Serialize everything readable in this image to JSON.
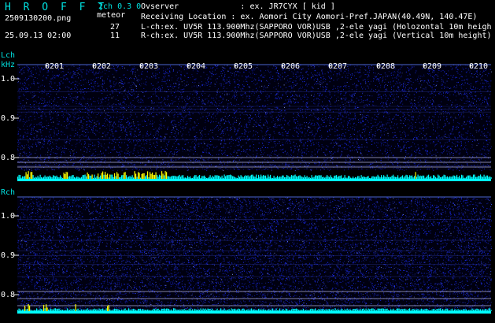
{
  "header": {
    "title": "H R O F F T",
    "mode": "2ch 0.3 0",
    "subtitle": "meteor",
    "filename": "2509130200.png",
    "datetime": "25.09.13 02:00",
    "count_l": "27",
    "count_r": "11",
    "observer": "Ovserver             : ex. JR7CYX [ kid ]",
    "location": "Receiving Location : ex. Aomori City Aomori-Pref.JAPAN(40.49N, 140.47E)",
    "lch_info": "L-ch:ex. UV5R 113.900Mhz(SAPPORO VOR)USB ,2-ele yagi (Holozontal 10m heigh",
    "rch_info": "R-ch:ex. UV5R 113.900Mhz(SAPPORO VOR)USB ,2-ele yagi (Vertical 10m height)"
  },
  "lch_panel": {
    "label_ch": "Lch",
    "label_unit": "kHz",
    "y_ticks": [
      "1.0",
      "0.9",
      "0.8"
    ]
  },
  "rch_panel": {
    "label_ch": "Rch",
    "y_ticks": [
      "1.0",
      "0.9",
      "0.8"
    ]
  },
  "time_ticks": [
    "0201",
    "0202",
    "0203",
    "0204",
    "0205",
    "0206",
    "0207",
    "0208",
    "0209",
    "0210"
  ],
  "colors": {
    "background": "#000000",
    "noise": "#1a2cff",
    "activity_cyan": "#00ffff",
    "activity_yellow": "#ffff00",
    "guide_line": "#d0d0ff"
  }
}
